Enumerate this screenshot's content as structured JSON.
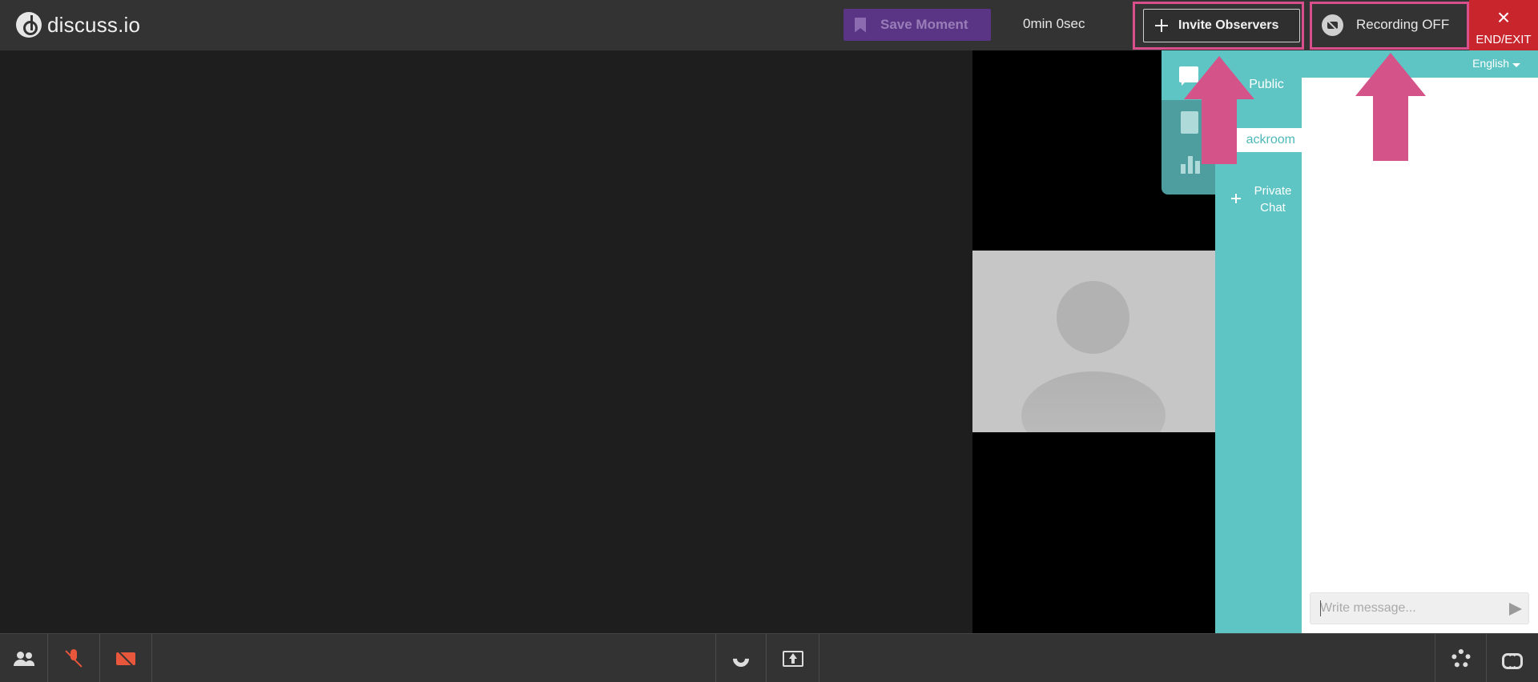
{
  "app": {
    "logo_text": "discuss.io"
  },
  "toolbar": {
    "save_moment_label": "Save Moment",
    "timer": "0min 0sec",
    "invite_label": "Invite Observers",
    "recording_label": "Recording OFF",
    "end_icon": "×",
    "end_label": "END/EXIT"
  },
  "chat": {
    "language": "English",
    "tabs": {
      "public": "Public",
      "backroom": "ackroom",
      "private_line1": "Private",
      "private_line2": "Chat"
    },
    "input_placeholder": "Write message..."
  },
  "colors": {
    "teal": "#5ec4c4",
    "highlight": "#d94f8c",
    "end": "#c9252c",
    "save_moment": "#5a3585"
  },
  "icons": {
    "side_nav": [
      "chat-icon",
      "notes-icon",
      "chart-icon"
    ],
    "bottom_left": [
      "participants-icon",
      "mic-off-icon",
      "camera-off-icon"
    ],
    "bottom_center": [
      "phone-icon",
      "screen-share-icon"
    ],
    "bottom_right": [
      "settings-icon",
      "link-icon"
    ]
  }
}
